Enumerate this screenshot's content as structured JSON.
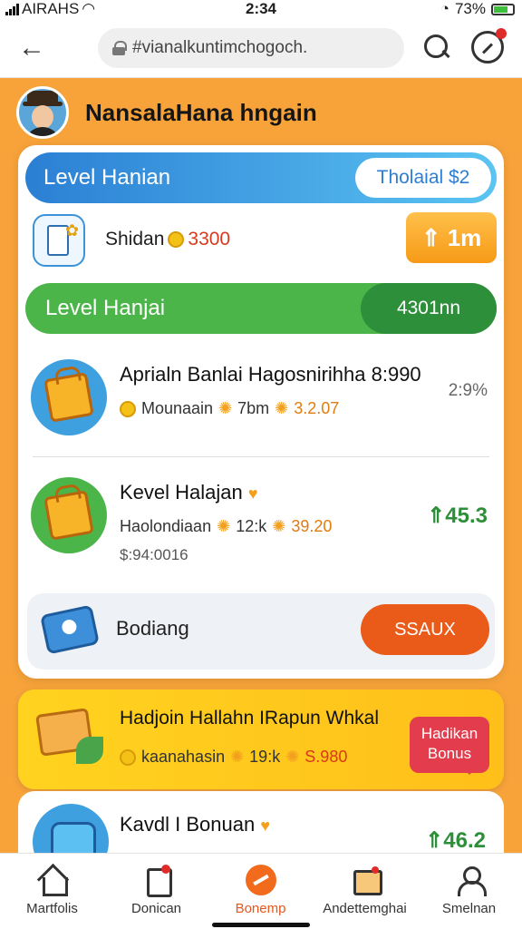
{
  "status_bar": {
    "carrier": "AIRAHS",
    "time": "2:34",
    "battery": "73%"
  },
  "browser": {
    "url": "#vianalkuntimchogoch."
  },
  "header": {
    "title": "NansalaHana hngain"
  },
  "level_card": {
    "level_banner": {
      "label": "Level Hanian",
      "pill": "Tholaial $2"
    },
    "reward": {
      "label": "Shidan",
      "value": "3300",
      "button": "1m"
    },
    "level_banner2": {
      "label": "Level Hanjai",
      "pill": "4301nn"
    },
    "items": [
      {
        "title": "Aprialn Banlai Hagosnirihha 8:990",
        "sub1": "Mounaain",
        "sub2": "7bm",
        "sub3": "3.2.07",
        "extra": "",
        "right": "2:9%"
      },
      {
        "title": "Kevel Halajan",
        "sub1": "Haolondiaan",
        "sub2": "12:k",
        "sub3": "39.20",
        "extra": "$:94:0016",
        "right": "45.3"
      }
    ],
    "bottom": {
      "label": "Bodiang",
      "button": "SSAUX"
    }
  },
  "promo": {
    "title": "Hadjoin Hallahn IRapun Whkal",
    "sub1": "kaanahasin",
    "sub2": "19:k",
    "sub3": "S.980",
    "badge": "Hadikan Bonus"
  },
  "partial": {
    "title": "Kavdl I Bonuan",
    "right": "46.2"
  },
  "tabs": [
    {
      "label": "Martfolis",
      "icon": "home-icon"
    },
    {
      "label": "Donican",
      "icon": "document-icon"
    },
    {
      "label": "Bonemp",
      "icon": "bonus-icon"
    },
    {
      "label": "Andettemghai",
      "icon": "map-icon"
    },
    {
      "label": "Smelnan",
      "icon": "user-icon"
    }
  ],
  "colors": {
    "background": "#f7a33a",
    "blue_banner": "#2b7fd4",
    "green_banner": "#4cb54a",
    "accent_orange": "#ea5a18",
    "promo_yellow": "#ffd31f",
    "positive_green": "#2e8f3a"
  }
}
